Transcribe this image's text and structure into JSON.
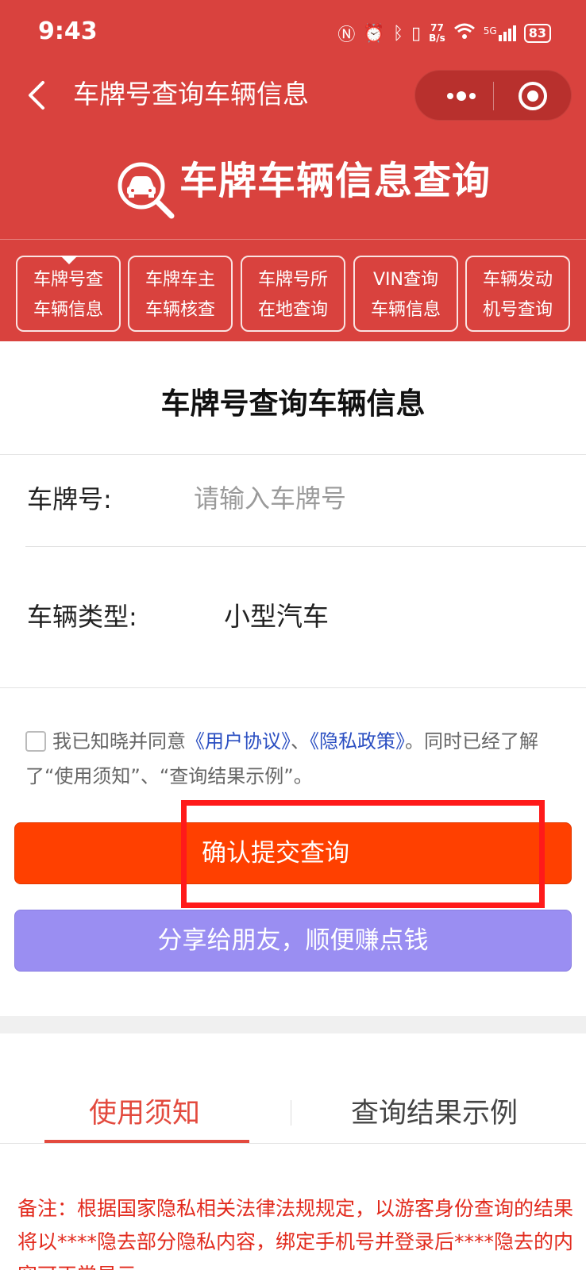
{
  "status_bar": {
    "time": "9:43",
    "speed_value": "77",
    "speed_unit": "B/s",
    "network": "5G",
    "battery": "83"
  },
  "nav": {
    "title": "车牌号查询车辆信息"
  },
  "hero": {
    "title": "车牌车辆信息查询",
    "logo_icon": "car-search-icon"
  },
  "tabs": [
    {
      "line1": "车牌号查",
      "line2": "车辆信息"
    },
    {
      "line1": "车牌车主",
      "line2": "车辆核查"
    },
    {
      "line1": "车牌号所",
      "line2": "在地查询"
    },
    {
      "line1": "VIN查询",
      "line2": "车辆信息"
    },
    {
      "line1": "车辆发动",
      "line2": "机号查询"
    }
  ],
  "form": {
    "title": "车牌号查询车辆信息",
    "plate_label": "车牌号:",
    "plate_placeholder": "请输入车牌号",
    "type_label": "车辆类型:",
    "type_value": "小型汽车"
  },
  "agreement": {
    "prefix": "我已知晓并同意",
    "link1": "《用户协议》",
    "sep": "、",
    "link2": "《隐私政策》",
    "suffix": "。同时已经了解了“使用须知”、“查询结果示例”。"
  },
  "buttons": {
    "submit": "确认提交查询",
    "share": "分享给朋友，顺便赚点钱"
  },
  "info_tabs": {
    "tab1": "使用须知",
    "tab2": "查询结果示例"
  },
  "note": "备注：根据国家隐私相关法律法规规定，以游客身份查询的结果将以****隐去部分隐私内容，绑定手机号并登录后****隐去的内容可正常显示。",
  "colors": {
    "brand": "#d9423e",
    "submit": "#ff4000",
    "share": "#9a8ef2",
    "link": "#2b4fc2",
    "note": "#e22b1e",
    "highlight": "#ff1a1a"
  }
}
